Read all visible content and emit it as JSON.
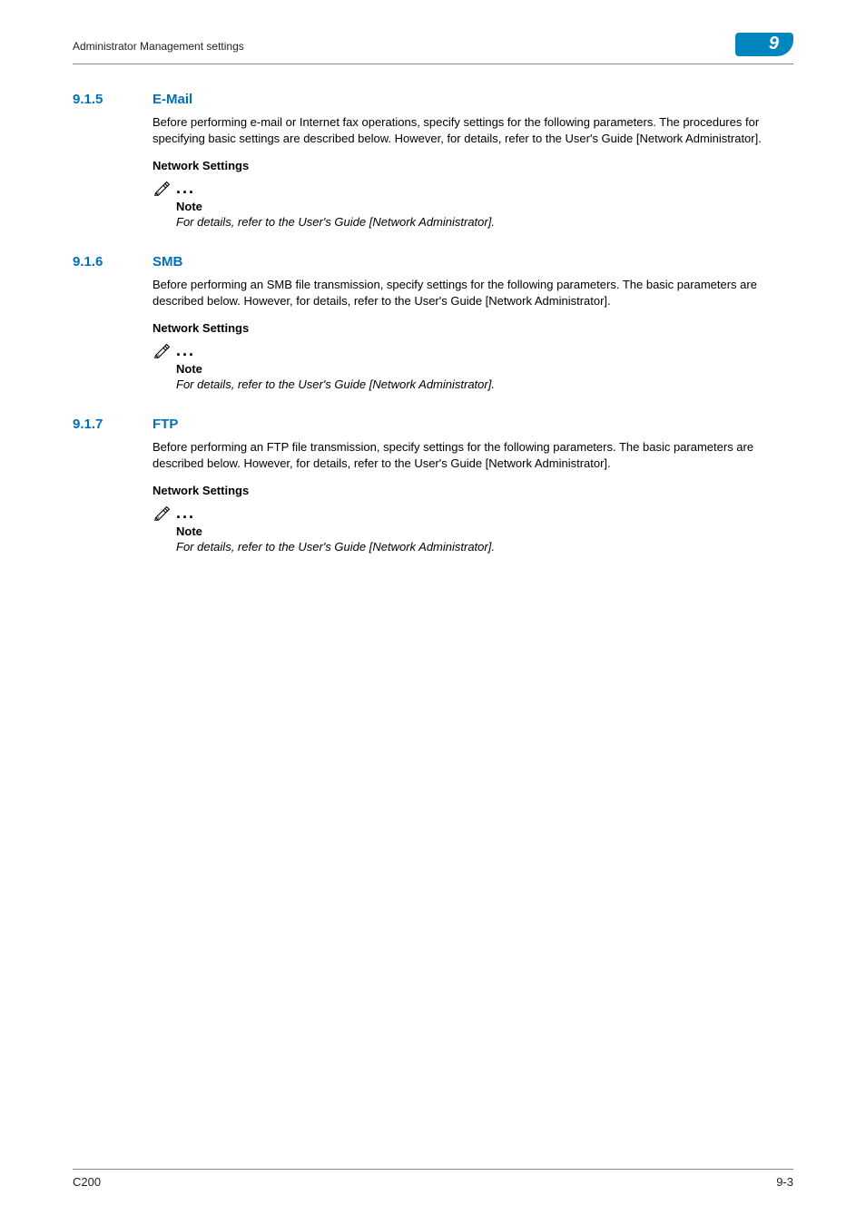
{
  "header": {
    "title": "Administrator Management settings",
    "chapter_number": "9"
  },
  "sections": [
    {
      "number": "9.1.5",
      "title": "E-Mail",
      "body": "Before performing e-mail or Internet fax operations, specify settings for the following parameters. The procedures for specifying basic settings are described below. However, for details, refer to the User's Guide [Network Administrator].",
      "subheading": "Network Settings",
      "note_label": "Note",
      "note_text": "For details, refer to the User's Guide [Network Administrator]."
    },
    {
      "number": "9.1.6",
      "title": "SMB",
      "body": "Before performing an SMB file transmission, specify settings for the following parameters. The basic parameters are described below. However, for details, refer to the User's Guide [Network Administrator].",
      "subheading": "Network Settings",
      "note_label": "Note",
      "note_text": "For details, refer to the User's Guide [Network Administrator]."
    },
    {
      "number": "9.1.7",
      "title": "FTP",
      "body": "Before performing an FTP file transmission, specify settings for the following parameters. The basic parameters are described below. However, for details, refer to the User's Guide [Network Administrator].",
      "subheading": "Network Settings",
      "note_label": "Note",
      "note_text": "For details, refer to the User's Guide [Network Administrator]."
    }
  ],
  "footer": {
    "model": "C200",
    "page": "9-3"
  },
  "note_dots": "..."
}
